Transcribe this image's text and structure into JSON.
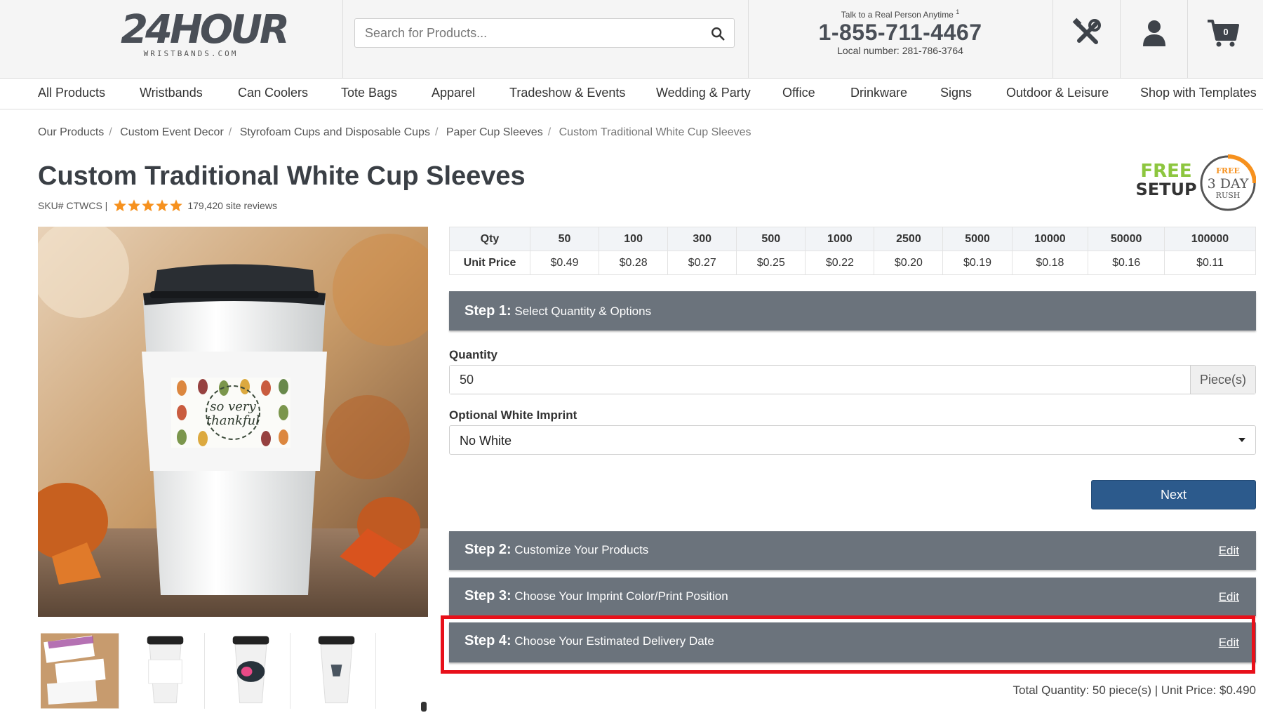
{
  "header": {
    "logo_main": "24HOUR",
    "logo_sub": "WRISTBANDS.COM",
    "search_placeholder": "Search for Products...",
    "talk_text": "Talk to a Real Person Anytime",
    "talk_sup": "1",
    "phone": "1-855-711-4467",
    "local": "Local number: 281-786-3764",
    "cart_count": "0"
  },
  "nav": [
    "All Products",
    "Wristbands",
    "Can Coolers",
    "Tote Bags",
    "Apparel",
    "Tradeshow & Events",
    "Wedding & Party",
    "Office",
    "Drinkware",
    "Signs",
    "Outdoor & Leisure",
    "Shop with Templates"
  ],
  "breadcrumb": [
    "Our Products",
    "Custom Event Decor",
    "Styrofoam Cups and Disposable Cups",
    "Paper Cup Sleeves",
    "Custom Traditional White Cup Sleeves"
  ],
  "product": {
    "title": "Custom Traditional White Cup Sleeves",
    "sku": "SKU# CTWCS |",
    "rating": 5,
    "reviews": "179,420 site reviews",
    "sleeve_text_1": "so very",
    "sleeve_text_2": "thankful"
  },
  "badge": {
    "free": "FREE",
    "setup": "SETUP",
    "free_small": "FREE",
    "day": "3 DAY",
    "rush": "RUSH"
  },
  "price_table": {
    "qty_label": "Qty",
    "price_label": "Unit Price",
    "quantities": [
      "50",
      "100",
      "300",
      "500",
      "1000",
      "2500",
      "5000",
      "10000",
      "50000",
      "100000"
    ],
    "prices": [
      "$0.49",
      "$0.28",
      "$0.27",
      "$0.25",
      "$0.22",
      "$0.20",
      "$0.19",
      "$0.18",
      "$0.16",
      "$0.11"
    ]
  },
  "steps": [
    {
      "prefix": "Step 1:",
      "label": "Select Quantity & Options",
      "edit": ""
    },
    {
      "prefix": "Step 2:",
      "label": "Customize Your Products",
      "edit": "Edit"
    },
    {
      "prefix": "Step 3:",
      "label": "Choose Your Imprint Color/Print Position",
      "edit": "Edit"
    },
    {
      "prefix": "Step 4:",
      "label": "Choose Your Estimated Delivery Date",
      "edit": "Edit"
    }
  ],
  "form": {
    "quantity_label": "Quantity",
    "quantity_value": "50",
    "quantity_unit": "Piece(s)",
    "imprint_label": "Optional White Imprint",
    "imprint_value": "No White",
    "next_label": "Next"
  },
  "total": "Total Quantity: 50 piece(s) | Unit Price: $0.490",
  "colors": {
    "step_bg": "#6b737c",
    "next_btn": "#2c5a8c",
    "highlight": "#e8101a",
    "star": "#f6911e",
    "badge_green": "#8dc63f"
  }
}
